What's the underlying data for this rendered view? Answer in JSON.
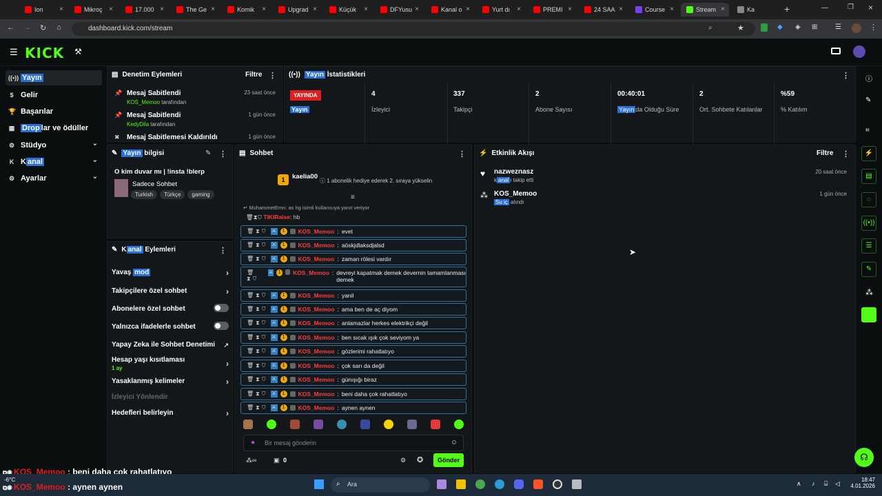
{
  "browser": {
    "tabs": [
      {
        "label": "Ion"
      },
      {
        "label": "Mikroç"
      },
      {
        "label": "17.000"
      },
      {
        "label": "The Ge"
      },
      {
        "label": "Komik"
      },
      {
        "label": "Upgrad"
      },
      {
        "label": "Küçük"
      },
      {
        "label": "DFYusu"
      },
      {
        "label": "Kanal o"
      },
      {
        "label": "Yurt dı"
      },
      {
        "label": "PREMI"
      },
      {
        "label": "24 SAA"
      },
      {
        "label": "Course"
      },
      {
        "label": "Stream"
      },
      {
        "label": "Ka"
      }
    ],
    "url": "dashboard.kick.com/stream"
  },
  "header": {
    "logo": "KICK"
  },
  "sidebar": {
    "items": [
      {
        "label": "Yayın"
      },
      {
        "label": "Gelir"
      },
      {
        "label": "Başarılar"
      },
      {
        "label_hl": "Drop",
        "label_rest": "lar ve ödüller"
      },
      {
        "label": "Stüdyo"
      },
      {
        "label_pre": "K",
        "label_hl": "anal"
      },
      {
        "label": "Ayarlar"
      }
    ]
  },
  "moderation": {
    "title": "Denetim Eylemleri",
    "filter": "Filtre",
    "items": [
      {
        "title": "Mesaj Sabitlendi",
        "user": "KOS_Memoo",
        "suffix": "tarafından",
        "time": "23 saat önce"
      },
      {
        "title": "Mesaj Sabitlendi",
        "user": "KedyDila",
        "suffix": "tarafından",
        "time": "1 gün önce"
      },
      {
        "title": "Mesaj Sabitlemesi Kaldırıldı",
        "time": "1 gün önce"
      }
    ]
  },
  "stats": {
    "title_hl": "Yayın",
    "title_rest": " İstatistikleri",
    "live_badge": "YAYINDA",
    "live_label": "Yayın",
    "cells": [
      {
        "value": "4",
        "label": "İzleyici"
      },
      {
        "value": "337",
        "label": "Takipçi"
      },
      {
        "value": "2",
        "label": "Abone Sayısı"
      },
      {
        "value": "00:40:01",
        "label_hl": "Yayın",
        "label_rest": "da Olduğu Süre"
      },
      {
        "value": "2",
        "label": "Ort. Sohbete Katılanlar"
      },
      {
        "value": "%59",
        "label": "% Katılım"
      }
    ]
  },
  "streaminfo": {
    "title_hl": "Yayın",
    "title_rest": " bilgisi",
    "stream_title": "O kim duvar mı | !insta !blerp",
    "category": "Sadece Sohbet",
    "tags": [
      "Turkish",
      "Türkçe",
      "gaming"
    ]
  },
  "channel_actions": {
    "title_pre": "K",
    "title_hl": "anal",
    "title_rest": " Eylemleri",
    "items": [
      {
        "label_pre": "Yavaş ",
        "label_hl": "mod"
      },
      {
        "label": "Takipçilere özel sohbet"
      },
      {
        "label": "Abonelere özel sohbet"
      },
      {
        "label": "Yalnızca ifadelerle sohbet"
      },
      {
        "label": "Yapay Zeka ile Sohbet Denetimi"
      },
      {
        "label": "Hesap yaşı kısıtlaması",
        "sub": "1 ay"
      },
      {
        "label": "Yasaklanmış kelimeler"
      },
      {
        "label": "İzleyici Yönlendir"
      },
      {
        "label": "Hedefleri belirleyin"
      }
    ]
  },
  "chat": {
    "title": "Sohbet",
    "pinned_user": "kaelia00",
    "pinned_badge": "1",
    "promo": "1 abonelik hediye ederek 2. sıraya yükselin",
    "reply_to": "MuhammetEmn: as hg isimli kullanıcıya yanıt veriyor",
    "first_user": "TIKIRaise",
    "first_text": "hb",
    "messages": [
      {
        "user": "KOS_Memoo",
        "text": "evet"
      },
      {
        "user": "KOS_Memoo",
        "text": "aöskjdlaksdjalsd"
      },
      {
        "user": "KOS_Memoo",
        "text": "zaman rölesi vardır"
      },
      {
        "user": "KOS_Memoo",
        "text": "devreyi kapatmak demek devernin tamamlanması demek"
      },
      {
        "user": "KOS_Memoo",
        "text": "yanil"
      },
      {
        "user": "KOS_Memoo",
        "text": "ama ben de aç diyom"
      },
      {
        "user": "KOS_Memoo",
        "text": "anlamazlar herkes elektrikçi değil"
      },
      {
        "user": "KOS_Memoo",
        "text": "ben sıcak ışık çok seviyom ya"
      },
      {
        "user": "KOS_Memoo",
        "text": "gözlerimi rahatlatıyo"
      },
      {
        "user": "KOS_Memoo",
        "text": "çok sarı da değil"
      },
      {
        "user": "KOS_Memoo",
        "text": "günışığı biraz"
      },
      {
        "user": "KOS_Memoo",
        "text": "beni daha çok rahatlatıyo"
      },
      {
        "user": "KOS_Memoo",
        "text": "aynen aynen"
      }
    ],
    "input_placeholder": "Bir mesaj gönderin",
    "count": "0",
    "send": "Gönder"
  },
  "activity": {
    "title": "Etkinlik Akışı",
    "filter": "Filtre",
    "events": [
      {
        "name": "nazweznasz",
        "sub_pre": "k",
        "sub_hl": "anal",
        "sub_rest": "ı takip etti",
        "time": "20 saat önce"
      },
      {
        "name": "KOS_Memoo",
        "sub_hl": "Su iç",
        "sub_rest": " alındı",
        "time": "1 gün önce"
      }
    ]
  },
  "overlay": {
    "line1_user": "KOS_Memoo",
    "line1_text": ": beni daha çok rahatlatıyo",
    "line2_user": "KOS_Memoo",
    "line2_text": ": aynen aynen"
  },
  "taskbar": {
    "weather": "-6°C",
    "search": "Ara",
    "time": "18:47",
    "date": "4.01.2026"
  }
}
